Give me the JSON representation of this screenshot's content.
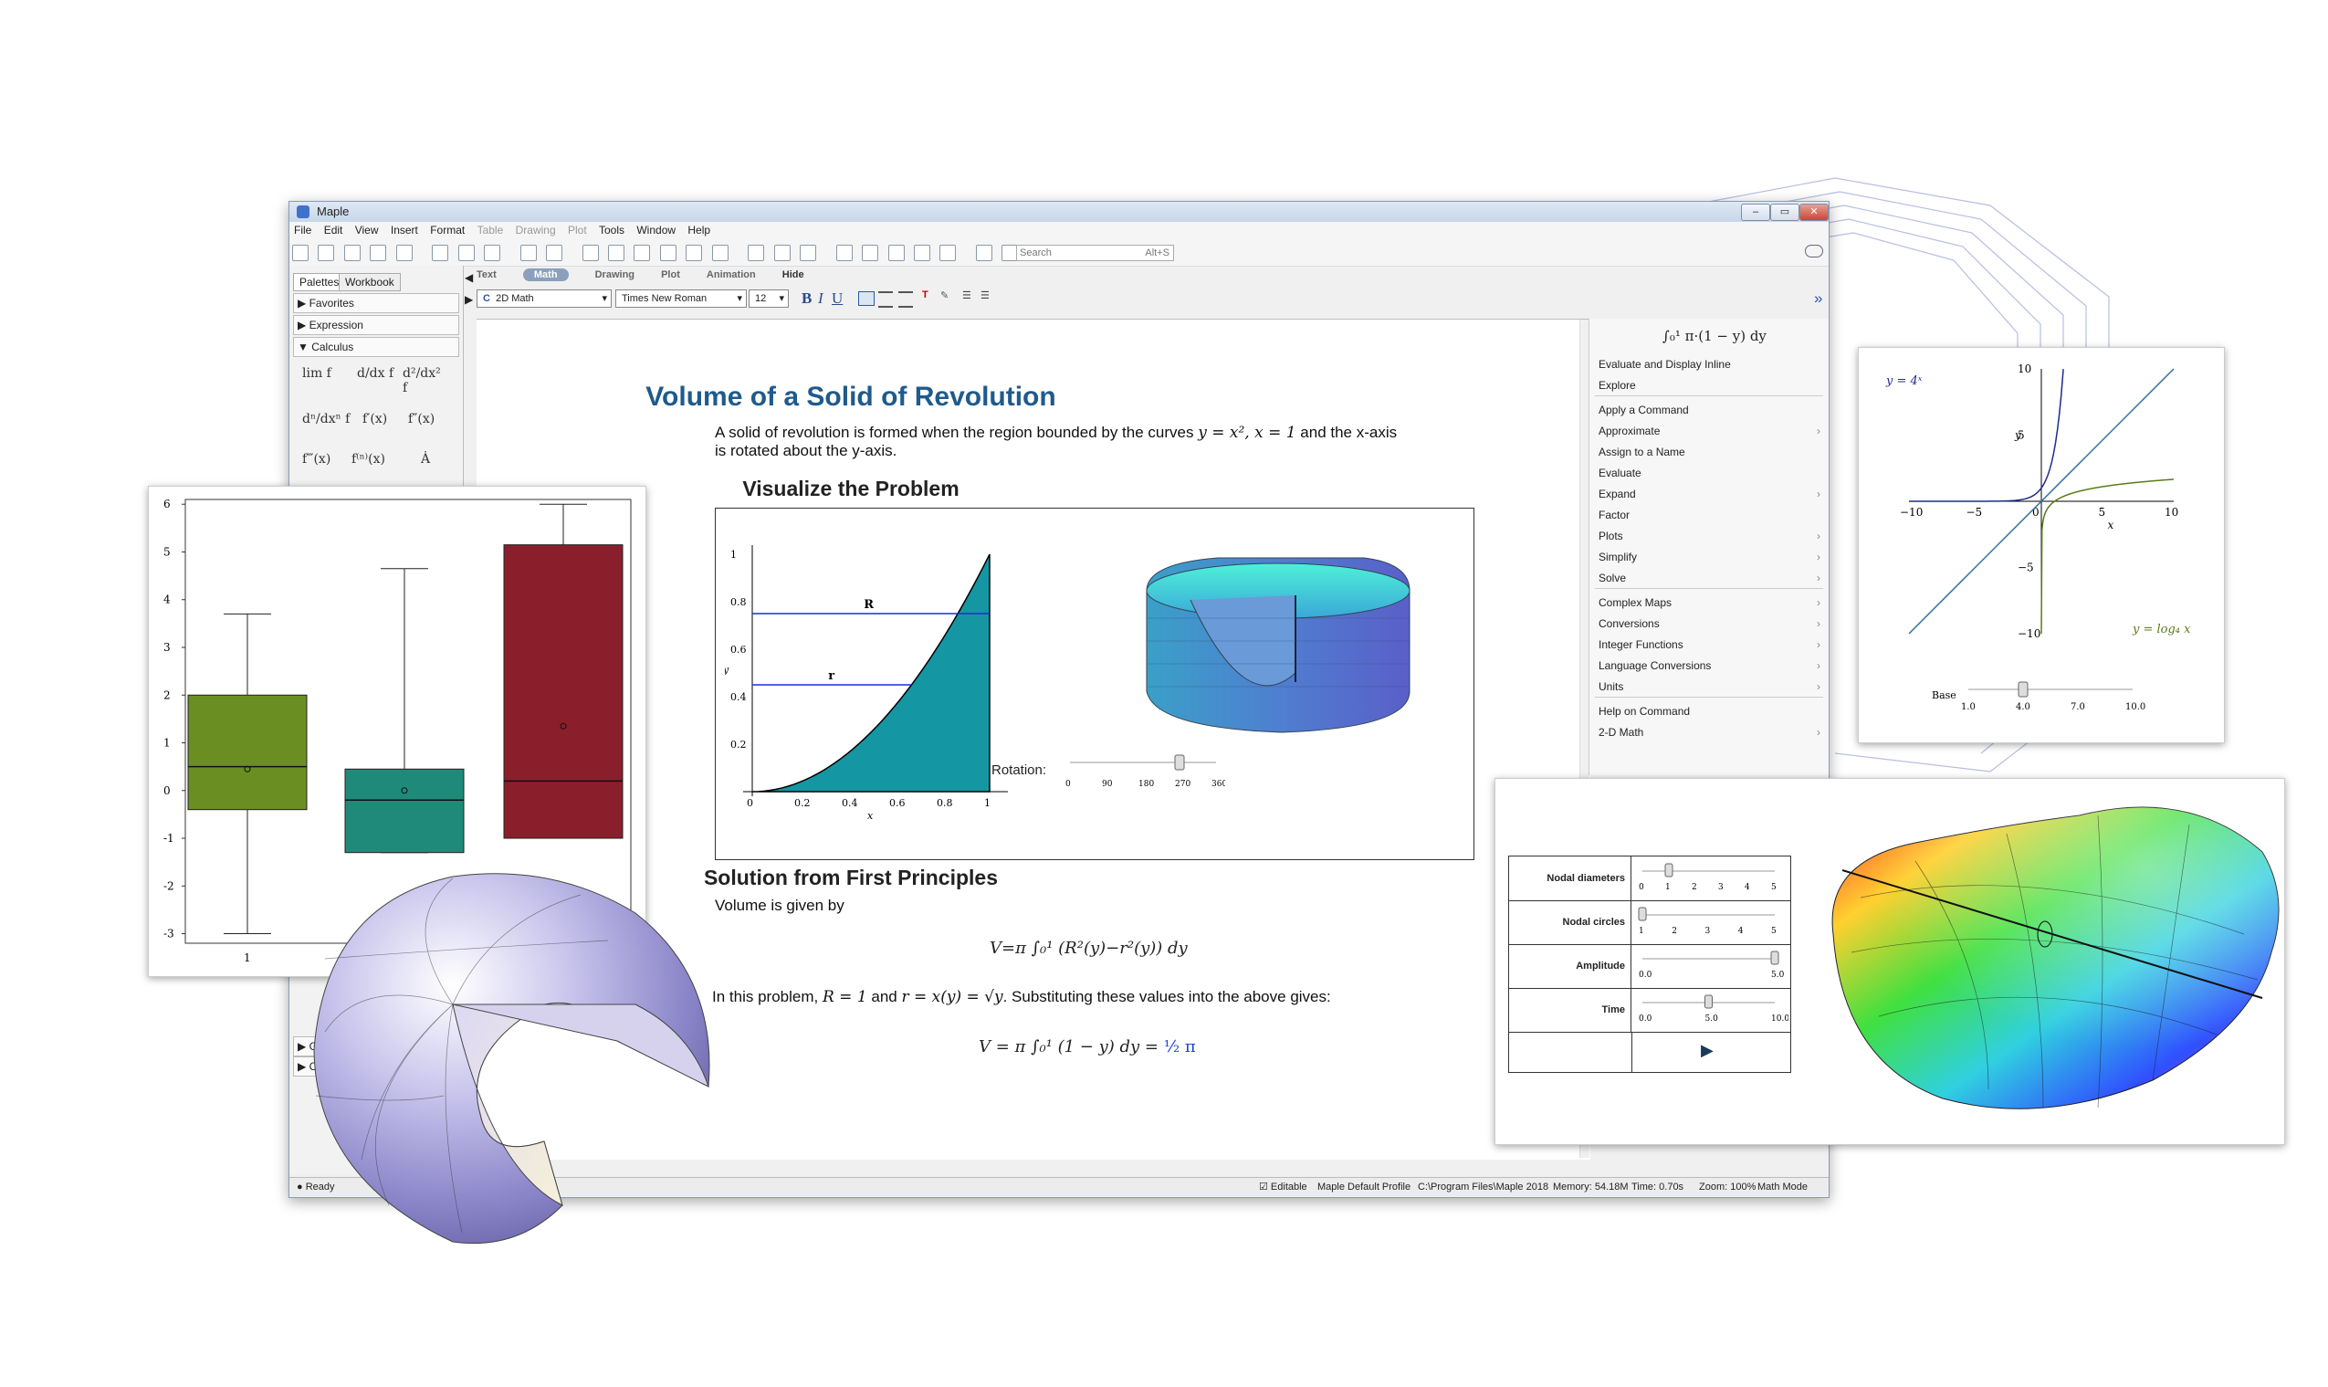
{
  "window": {
    "title": "Maple",
    "menu": [
      "File",
      "Edit",
      "View",
      "Insert",
      "Format",
      "Table",
      "Drawing",
      "Plot",
      "Tools",
      "Window",
      "Help"
    ],
    "menu_dim": [
      "Table",
      "Drawing",
      "Plot"
    ],
    "search_placeholder": "Search",
    "search_shortcut": "Alt+S"
  },
  "left_panel": {
    "tabs": [
      "Palettes",
      "Workbook"
    ],
    "sections": [
      "Favorites",
      "Expression",
      "Calculus"
    ],
    "calculus_items": [
      "lim f",
      "d/dx f",
      "d²/dx² f",
      "dⁿ/dxⁿ f",
      "f′(x)",
      "f″(x)",
      "f‴(x)",
      "f⁽ⁿ⁾(x)",
      "Ȧ"
    ],
    "lower_sections": [
      "Gr",
      "C"
    ]
  },
  "context_bar": {
    "modes": [
      "Text",
      "Math",
      "Drawing",
      "Plot",
      "Animation",
      "Hide"
    ],
    "active": "Math"
  },
  "format_bar": {
    "input_mode": "2D Math",
    "font": "Times New Roman",
    "size": "12"
  },
  "document": {
    "title": "Volume of a Solid of Revolution",
    "intro_1": "A solid of revolution is formed when the region bounded by the curves",
    "intro_curves": "y = x², x = 1",
    "intro_2": "and the x-axis",
    "intro_3": "is rotated about the y-axis.",
    "h_visualize": "Visualize the Problem",
    "rotation_label": "Rotation:",
    "rotation_ticks": [
      "0",
      "90",
      "180",
      "270",
      "360"
    ],
    "rotation_value": 270,
    "h_solution": "Solution from First Principles",
    "volume_text": "Volume is given by",
    "volume_formula": "V=π ∫₀¹ (R²(y)−r²(y)) dy",
    "problem_text_1": "In this problem,",
    "problem_R": "R = 1",
    "problem_and": "and",
    "problem_r": "r = x(y) = √y",
    "problem_text_2": ". Substituting these values into the above gives:",
    "result_formula": "V = π ∫₀¹ (1 − y) dy =",
    "result_value": "½ π"
  },
  "region_plot": {
    "x_ticks": [
      "0",
      "0.2",
      "0.4",
      "0.6",
      "0.8",
      "1"
    ],
    "y_ticks": [
      "0.2",
      "0.4",
      "0.6",
      "0.8",
      "1"
    ],
    "xlabel": "x",
    "ylabel": "y",
    "labels": [
      "R",
      "r"
    ]
  },
  "context_menu": {
    "header": "∫₀¹ π·(1 − y) dy",
    "items": [
      {
        "label": "Evaluate and Display Inline",
        "sub": false
      },
      {
        "label": "Explore",
        "sub": false
      },
      {
        "label": "Apply a Command",
        "sub": false
      },
      {
        "label": "Approximate",
        "sub": true
      },
      {
        "label": "Assign to a Name",
        "sub": false
      },
      {
        "label": "Evaluate",
        "sub": false
      },
      {
        "label": "Expand",
        "sub": true
      },
      {
        "label": "Factor",
        "sub": false
      },
      {
        "label": "Plots",
        "sub": true
      },
      {
        "label": "Simplify",
        "sub": true
      },
      {
        "label": "Solve",
        "sub": true
      },
      {
        "label": "Complex Maps",
        "sub": true
      },
      {
        "label": "Conversions",
        "sub": true
      },
      {
        "label": "Integer Functions",
        "sub": true
      },
      {
        "label": "Language Conversions",
        "sub": true
      },
      {
        "label": "Units",
        "sub": true
      },
      {
        "label": "Help on Command",
        "sub": false
      },
      {
        "label": "2-D Math",
        "sub": true
      }
    ]
  },
  "status": {
    "left": "Ready",
    "editable": "Editable",
    "profile": "Maple Default Profile",
    "path": "C:\\Program Files\\Maple 2018",
    "memory": "Memory: 54.18M",
    "time": "Time: 0.70s",
    "zoom": "Zoom: 100%",
    "mode": "Math Mode"
  },
  "chart_data": [
    {
      "type": "box",
      "categories": [
        "1"
      ],
      "ylim": [
        -3.2,
        6.1
      ],
      "y_ticks": [
        "-3",
        "-2",
        "-1",
        "0",
        "1",
        "2",
        "3",
        "4",
        "5",
        "6"
      ],
      "series": [
        {
          "color": "#6b8e23",
          "whisker_low": -3.0,
          "q1": -0.4,
          "median": 0.5,
          "q3": 2.0,
          "whisker_high": 3.7,
          "mean": 0.45
        },
        {
          "color": "#1f8a7a",
          "whisker_low": -1.3,
          "q1": -1.3,
          "median": -0.2,
          "q3": 0.45,
          "whisker_high": 4.65,
          "mean": 0.0
        },
        {
          "color": "#8b1e2b",
          "whisker_low": -1.0,
          "q1": -1.0,
          "median": 0.2,
          "q3": 5.15,
          "whisker_high": 6.0,
          "mean": 1.35
        }
      ]
    },
    {
      "type": "line",
      "title_labels": [
        "y = 4ˣ",
        "y = log₄ x"
      ],
      "xlim": [
        -10,
        10
      ],
      "ylim": [
        -10,
        10
      ],
      "x_ticks": [
        "−10",
        "−5",
        "0",
        "5",
        "10"
      ],
      "y_ticks": [
        "10",
        "5",
        "−5",
        "−10"
      ],
      "xlabel": "x",
      "ylabel": "y",
      "series": [
        {
          "name": "y = 4ˣ",
          "color": "#1f2a8c"
        },
        {
          "name": "y = x",
          "color": "#2f6f9a"
        },
        {
          "name": "y = log₄ x",
          "color": "#5a7a1a"
        }
      ],
      "slider": {
        "label": "Base",
        "ticks": [
          "1.0",
          "4.0",
          "7.0",
          "10.0"
        ],
        "value": 4.0
      }
    }
  ],
  "wave_controls": {
    "rows": [
      {
        "label": "Nodal diameters",
        "ticks": [
          "0",
          "1",
          "2",
          "3",
          "4",
          "5"
        ],
        "value": 1
      },
      {
        "label": "Nodal circles",
        "ticks": [
          "1",
          "2",
          "3",
          "4",
          "5"
        ],
        "value": 1
      },
      {
        "label": "Amplitude",
        "ticks": [
          "0.0",
          "5.0"
        ],
        "value": 5.0
      },
      {
        "label": "Time",
        "ticks": [
          "0.0",
          "5.0",
          "10.0"
        ],
        "value": 5.0
      }
    ]
  }
}
